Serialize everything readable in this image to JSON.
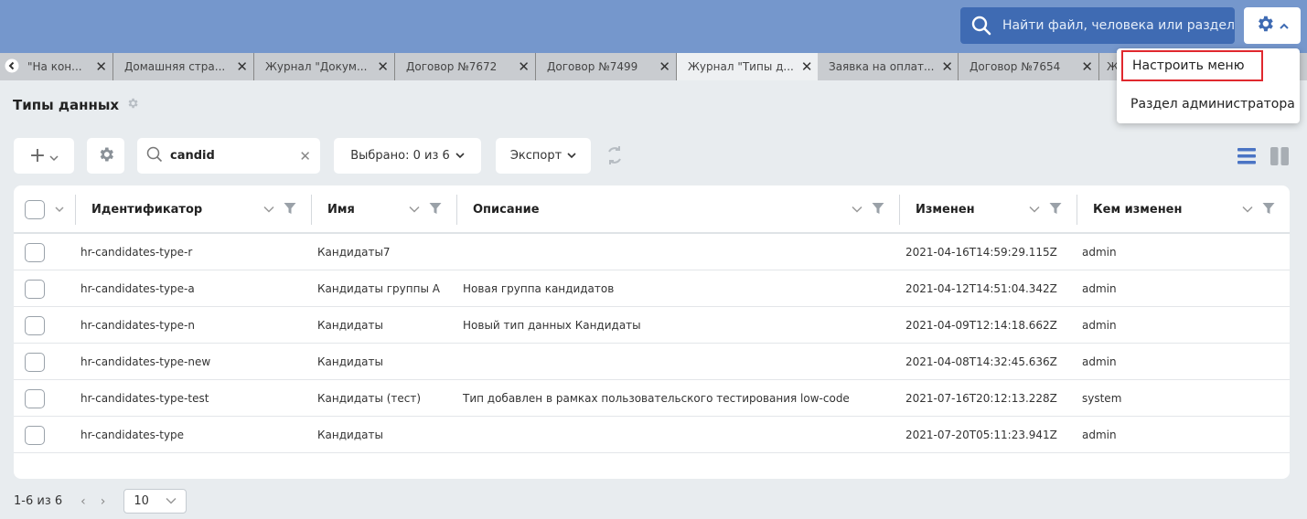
{
  "header": {
    "search_placeholder": "Найти файл, человека или раздел",
    "search_icon": "search-icon",
    "settings_icon": "gear-icon"
  },
  "tabs": [
    {
      "label": "\"На кон...",
      "active": false
    },
    {
      "label": "Домашняя стра...",
      "active": false
    },
    {
      "label": "Журнал \"Докум...",
      "active": false
    },
    {
      "label": "Договор №7672",
      "active": false
    },
    {
      "label": "Договор №7499",
      "active": false
    },
    {
      "label": "Журнал \"Типы д...",
      "active": true
    },
    {
      "label": "Заявка на оплат...",
      "active": false
    },
    {
      "label": "Договор №7654",
      "active": false
    },
    {
      "label": "Ж",
      "active": false
    }
  ],
  "settings_menu": {
    "items": [
      "Настроить меню",
      "Раздел администратора"
    ],
    "highlighted": "Настроить меню"
  },
  "page": {
    "title": "Типы данных"
  },
  "toolbar": {
    "add_label": "+",
    "search_value": "candid",
    "selected_label": "Выбрано: 0 из 6",
    "export_label": "Экспорт"
  },
  "table": {
    "columns": [
      "Идентификатор",
      "Имя",
      "Описание",
      "Изменен",
      "Кем изменен"
    ],
    "rows": [
      {
        "id": "hr-candidates-type-r",
        "name": "Кандидаты7",
        "desc": "",
        "modified": "2021-04-16T14:59:29.115Z",
        "by": "admin"
      },
      {
        "id": "hr-candidates-type-a",
        "name": "Кандидаты группы А",
        "desc": "Новая группа кандидатов",
        "modified": "2021-04-12T14:51:04.342Z",
        "by": "admin"
      },
      {
        "id": "hr-candidates-type-n",
        "name": "Кандидаты",
        "desc": "Новый тип данных Кандидаты",
        "modified": "2021-04-09T12:14:18.662Z",
        "by": "admin"
      },
      {
        "id": "hr-candidates-type-new",
        "name": "Кандидаты",
        "desc": "",
        "modified": "2021-04-08T14:32:45.636Z",
        "by": "admin"
      },
      {
        "id": "hr-candidates-type-test",
        "name": "Кандидаты (тест)",
        "desc": "Тип добавлен в рамках пользовательского тестирования low-code",
        "modified": "2021-07-16T20:12:13.228Z",
        "by": "system"
      },
      {
        "id": "hr-candidates-type",
        "name": "Кандидаты",
        "desc": "",
        "modified": "2021-07-20T05:11:23.941Z",
        "by": "admin"
      }
    ]
  },
  "pagination": {
    "range": "1-6 из 6",
    "page_size": "10"
  },
  "colors": {
    "header": "#7597cc",
    "search": "#3f6bb3",
    "highlight": "#e0282e",
    "accent": "#4a74c4"
  }
}
